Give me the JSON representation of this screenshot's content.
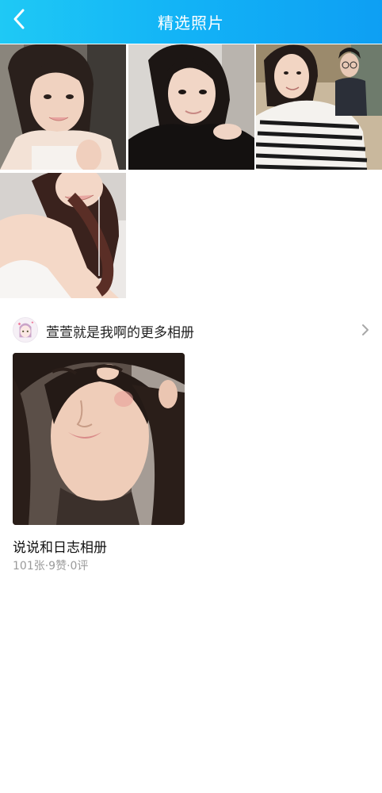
{
  "header": {
    "title": "精选照片",
    "back_icon": "chevron-left-icon",
    "background": "#12b2f6"
  },
  "featured_photos": [
    {
      "icon": "photo-girl-white-top"
    },
    {
      "icon": "photo-girl-black-top"
    },
    {
      "icon": "photo-girl-striped-top"
    },
    {
      "icon": "photo-girl-shoulder"
    }
  ],
  "album_section": {
    "owner_label": "萱萱就是我啊的更多相册",
    "chevron_icon": "chevron-right-icon"
  },
  "album": {
    "name": "说说和日志相册",
    "meta": "101张·9赞·0评"
  }
}
